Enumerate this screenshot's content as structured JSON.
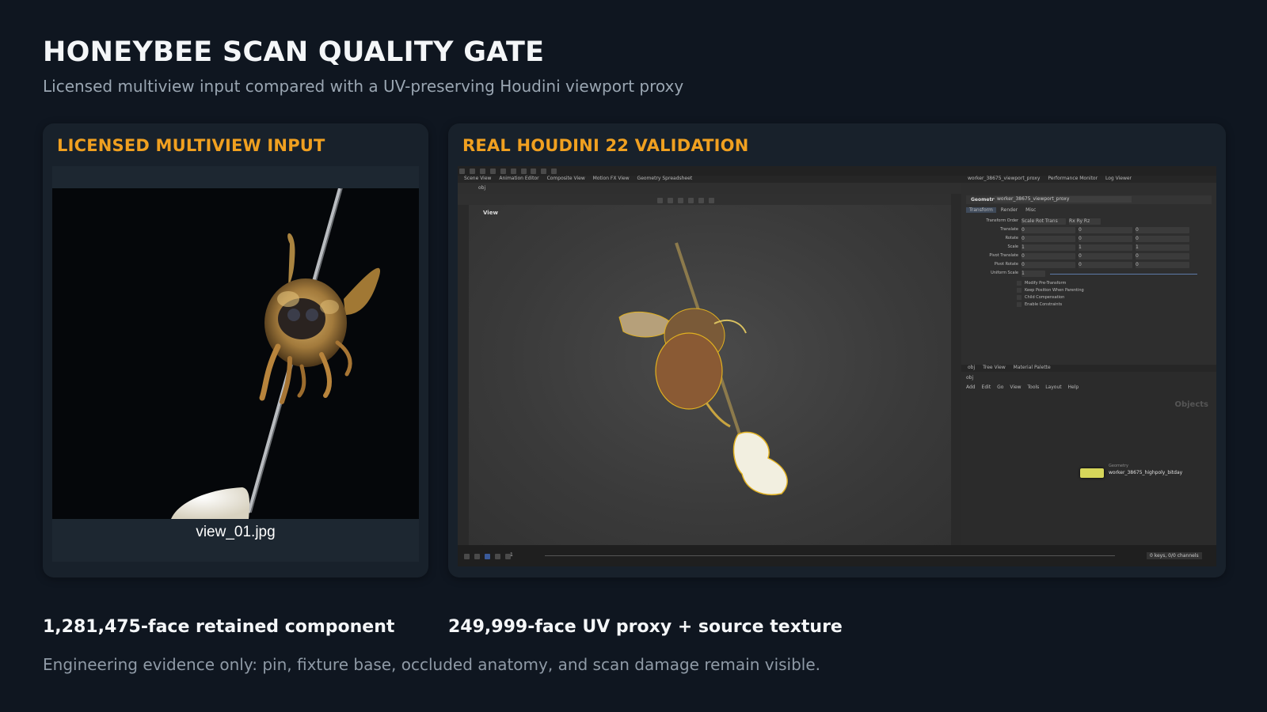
{
  "header": {
    "title": "HONEYBEE SCAN QUALITY GATE",
    "subtitle": "Licensed multiview input compared with a UV-preserving Houdini viewport proxy"
  },
  "left_panel": {
    "heading": "LICENSED MULTIVIEW INPUT",
    "image_caption": "view_01.jpg"
  },
  "right_panel": {
    "heading": "REAL HOUDINI 22 VALIDATION",
    "houdini": {
      "desktop_tabs": [
        "Scene View",
        "Animation Editor",
        "Composite View",
        "Motion FX View",
        "Geometry Spreadsheet"
      ],
      "path": "obj",
      "viewport_label": "View",
      "right_tabs": [
        "worker_38675_viewport_proxy",
        "Performance Monitor",
        "Log Viewer"
      ],
      "param_header": "Geometry",
      "node_name_field": "worker_38675_viewport_proxy",
      "param_tabs": [
        "Transform",
        "Render",
        "Misc"
      ],
      "params": [
        {
          "label": "Transform Order",
          "values": [
            "Scale Rot Trans",
            "Rx Ry Rz"
          ]
        },
        {
          "label": "Translate",
          "values": [
            "0",
            "0",
            "0"
          ]
        },
        {
          "label": "Rotate",
          "values": [
            "0",
            "0",
            "0"
          ]
        },
        {
          "label": "Scale",
          "values": [
            "1",
            "1",
            "1"
          ]
        },
        {
          "label": "Pivot Translate",
          "values": [
            "0",
            "0",
            "0"
          ]
        },
        {
          "label": "Pivot Rotate",
          "values": [
            "0",
            "0",
            "0"
          ]
        },
        {
          "label": "Uniform Scale",
          "values": [
            "1"
          ]
        }
      ],
      "checkboxes": [
        "Modify Pre-Transform",
        "Keep Position When Parenting",
        "Child Compensation",
        "Enable Constraints"
      ],
      "network_tabs": [
        "obj",
        "Tree View",
        "Material Palette"
      ],
      "network_menu": [
        "Add",
        "Edit",
        "Go",
        "View",
        "Tools",
        "Layout",
        "Help"
      ],
      "network_context": "Objects",
      "node_type": "Geometry",
      "node_label": "worker_38675_highpoly_bitday",
      "frame": "1",
      "channels_status": "0 keys, 0/0 channels"
    }
  },
  "stats": {
    "left": "1,281,475-face retained component",
    "right": "249,999-face UV proxy + source texture"
  },
  "footnote": "Engineering evidence only: pin, fixture base, occluded anatomy, and scan damage remain visible.",
  "colors": {
    "background": "#0f1620",
    "card": "#18212b",
    "accent": "#f0a020"
  }
}
